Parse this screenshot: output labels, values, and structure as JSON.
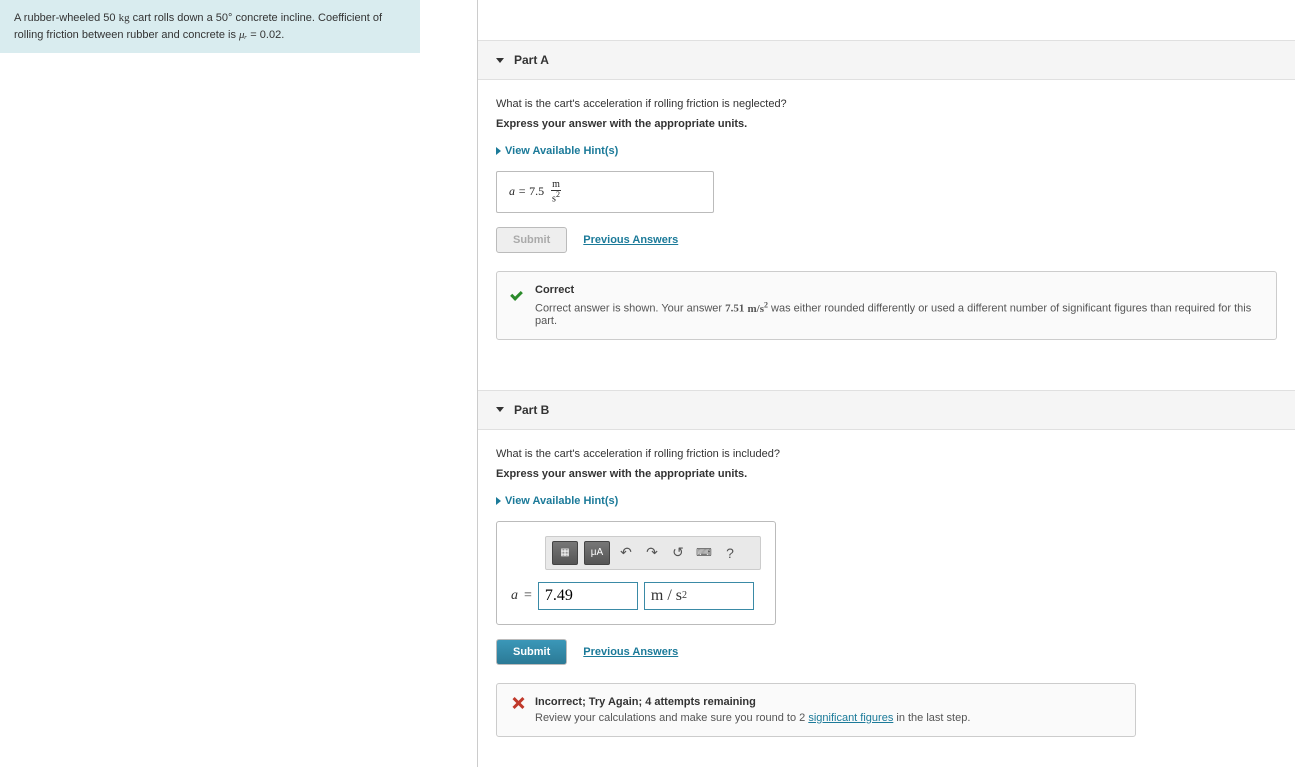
{
  "problem": {
    "text_before_mass": "A rubber-wheeled 50 ",
    "mass_unit": "kg",
    "text_mid": " cart rolls down a 50° concrete incline. Coefficient of rolling friction between rubber and concrete is ",
    "mu_symbol": "μᵣ",
    "mu_eq": " = 0.02."
  },
  "partA": {
    "title": "Part A",
    "question": "What is the cart's acceleration if rolling friction is neglected?",
    "instruction": "Express your answer with the appropriate units.",
    "hints_label": "View Available Hint(s)",
    "var": "a",
    "eq": " = ",
    "value": "7.5",
    "unit_num": "m",
    "unit_den": "s",
    "unit_exp": "2",
    "submit_label": "Submit",
    "prev_answers": "Previous Answers",
    "feedback_title": "Correct",
    "feedback_before": "Correct answer is shown. Your answer ",
    "feedback_val": "7.51",
    "feedback_unit_m": "m/s",
    "feedback_unit_exp": "2",
    "feedback_after": " was either rounded differently or used a different number of significant figures than required for this part."
  },
  "partB": {
    "title": "Part B",
    "question": "What is the cart's acceleration if rolling friction is included?",
    "instruction": "Express your answer with the appropriate units.",
    "hints_label": "View Available Hint(s)",
    "toolbar": {
      "templates_label": "▦",
      "mu_label": "μA",
      "help_label": "?"
    },
    "var": "a",
    "eq": " = ",
    "value": "7.49",
    "unit_display": "m / s",
    "unit_exp": "2",
    "submit_label": "Submit",
    "prev_answers": "Previous Answers",
    "feedback_title": "Incorrect; Try Again; 4 attempts remaining",
    "feedback_before": "Review your calculations and make sure you round to 2 ",
    "feedback_link": "significant figures",
    "feedback_after": " in the last step."
  }
}
